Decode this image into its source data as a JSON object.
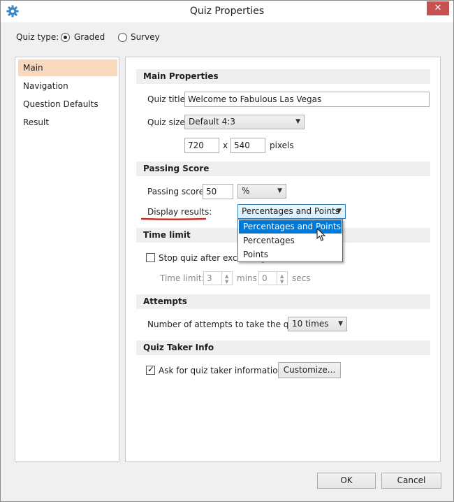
{
  "window": {
    "title": "Quiz Properties",
    "close_glyph": "✕",
    "app_icon": "gear-icon"
  },
  "quiz_type": {
    "label": "Quiz type:",
    "options": [
      {
        "label": "Graded",
        "selected": true
      },
      {
        "label": "Survey",
        "selected": false
      }
    ]
  },
  "sidebar": {
    "items": [
      {
        "label": "Main",
        "selected": true
      },
      {
        "label": "Navigation",
        "selected": false
      },
      {
        "label": "Question Defaults",
        "selected": false
      },
      {
        "label": "Result",
        "selected": false
      }
    ]
  },
  "main_properties": {
    "header": "Main Properties",
    "title_label": "Quiz title:",
    "title_value": "Welcome to Fabulous Las Vegas",
    "size_label": "Quiz size:",
    "size_value": "Default 4:3",
    "width_value": "720",
    "x_sep": "x",
    "height_value": "540",
    "unit": "pixels"
  },
  "passing_score": {
    "header": "Passing Score",
    "score_label": "Passing score:",
    "score_value": "50",
    "score_unit": "%",
    "display_label": "Display results:",
    "display_value": "Percentages and Points",
    "display_options": [
      "Percentages and Points",
      "Percentages",
      "Points"
    ],
    "highlighted_option": "Percentages and Points"
  },
  "time_limit": {
    "header": "Time limit",
    "checkbox_label": "Stop quiz after exceeding",
    "checked": false,
    "limit_label": "Time limit:",
    "mins_value": "3",
    "mins_unit": "mins",
    "secs_value": "0",
    "secs_unit": "secs"
  },
  "attempts": {
    "header": "Attempts",
    "label": "Number of attempts to take the quiz:",
    "value": "10 times"
  },
  "quiz_taker": {
    "header": "Quiz Taker Info",
    "checkbox_label": "Ask for quiz taker information",
    "checked": true,
    "customize_label": "Customize..."
  },
  "footer": {
    "ok_label": "OK",
    "cancel_label": "Cancel"
  },
  "colors": {
    "selection": "#f9d9be",
    "highlight": "#0078d7",
    "underline": "#c8302c",
    "close": "#c75050",
    "gear": "#3b86c9"
  }
}
